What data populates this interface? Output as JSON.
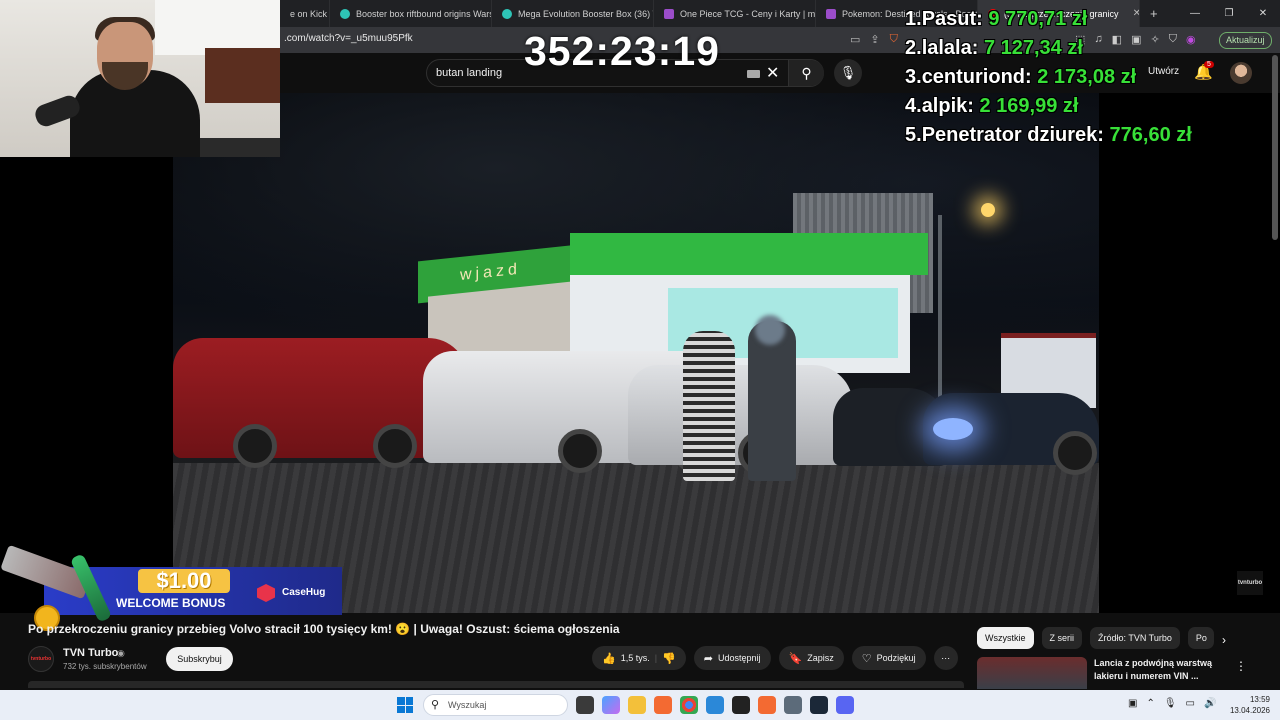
{
  "browser": {
    "tabs": [
      {
        "label": "e on Kick",
        "color": "#53fc18"
      },
      {
        "label": "Booster box riftbound origins Warsz",
        "color": "#2ec4b6"
      },
      {
        "label": "Mega Evolution Booster Box (36) W",
        "color": "#2ec4b6"
      },
      {
        "label": "One Piece TCG - Ceny i Karty | mTCG",
        "color": "#9b4dca"
      },
      {
        "label": "Pokemon: Destined Rivals - Booste",
        "color": "#9b4dca"
      },
      {
        "label": "(5) Po przekroczeniu granicy",
        "color": "#ff0000"
      }
    ],
    "new_tab": "+",
    "url": ".com/watch?v=_u5muu95Pfk",
    "update_label": "Aktualizuj"
  },
  "youtube": {
    "search_value": "butan landing",
    "create_label": "Utwórz",
    "notif_count": "5",
    "video_title": "Po przekroczeniu granicy przebieg Volvo stracił 100 tysięcy km! 😮 | Uwaga! Oszust: ściema ogłoszenia",
    "channel": {
      "name": "TVN Turbo",
      "subs": "732 tys. subskrybentów",
      "avatar_text": "tvnturbo",
      "verified": "◉"
    },
    "subscribe_label": "Subskrybuj",
    "actions": {
      "like": "1,5 tys.",
      "share": "Udostępnij",
      "save": "Zapisz",
      "thanks": "Podziękuj"
    },
    "watermark": "tvnturbo",
    "kiosk_sign": "wjazd",
    "chips": [
      "Wszystkie",
      "Z serii",
      "Źródło: TVN Turbo",
      "Po"
    ],
    "recommendation": {
      "title": "Lancia z podwójną warstwą lakieru i numerem VIN ..."
    }
  },
  "overlay": {
    "timer": "352:23:19",
    "leaderboard": [
      {
        "rank": "1.",
        "name": "Pasut:",
        "amount": "9 770,71 zł"
      },
      {
        "rank": "2.",
        "name": "lalala:",
        "amount": "7 127,34 zł"
      },
      {
        "rank": "3.",
        "name": "centuriond:",
        "amount": "2 173,08 zł"
      },
      {
        "rank": "4.",
        "name": "alpik:",
        "amount": "2 169,99 zł"
      },
      {
        "rank": "5.",
        "name": "Penetrator dziurek:",
        "amount": "776,60 zł"
      }
    ],
    "banner": {
      "price": "$1.00",
      "text": "WELCOME BONUS",
      "brand": "CaseHug"
    }
  },
  "taskbar": {
    "search_placeholder": "Wyszukaj",
    "time": "13:59",
    "date": "13.04.2026"
  }
}
